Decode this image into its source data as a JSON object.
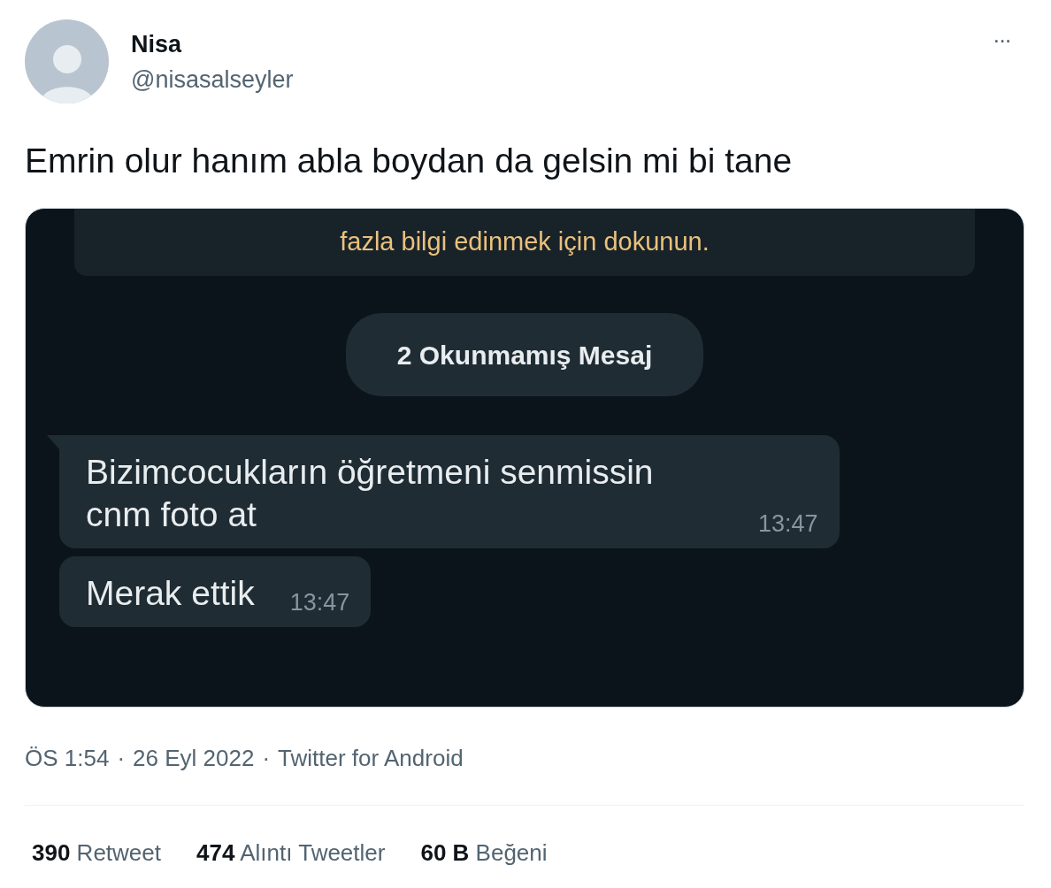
{
  "author": {
    "name": "Nisa",
    "handle": "@nisasalseyler"
  },
  "more_button": "···",
  "tweet_text": "Emrin olur hanım abla boydan da gelsin mi bi tane",
  "chat_screenshot": {
    "notice": "fazla bilgi edinmek için dokunun.",
    "unread_banner": "2 Okunmamış Mesaj",
    "messages": [
      {
        "text": "Bizimcocukların öğretmeni senmissin cnm foto at",
        "time": "13:47",
        "tail": true
      },
      {
        "text": "Merak ettik",
        "time": "13:47",
        "tail": false
      }
    ]
  },
  "meta": [
    "ÖS 1:54",
    "26 Eyl 2022",
    "Twitter for Android"
  ],
  "meta_separator": "·",
  "stats": [
    {
      "count": "390",
      "label": "Retweet"
    },
    {
      "count": "474",
      "label": "Alıntı Tweetler"
    },
    {
      "count": "60 B",
      "label": "Beğeni"
    }
  ]
}
